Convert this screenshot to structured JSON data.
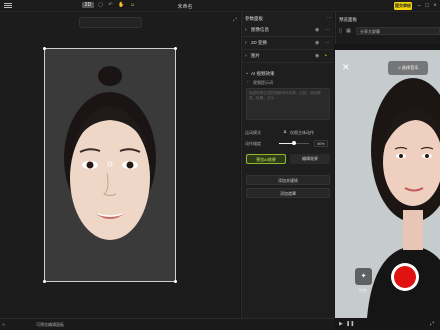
{
  "window": {
    "title": "未命名",
    "export_label": "提交审核"
  },
  "canvas": {
    "toolbar": {
      "mode_label": "2D",
      "undo_glyph": "↶",
      "redo_glyph": "↷",
      "hand_glyph": "✋",
      "face_glyph": "☺"
    },
    "expand_glyph": "⤢"
  },
  "bottom": {
    "left_label": "⟳",
    "tab_label": "可预览编辑面板"
  },
  "panel": {
    "title": "参数面板",
    "sections": [
      {
        "label": "图像信息",
        "icon": "chevron-right"
      },
      {
        "label": "2D 变换",
        "icon": "chevron-right"
      },
      {
        "label": "图片",
        "icon": "chevron-right"
      }
    ],
    "ai_section": "AI 视频效果",
    "ai_sub": "视频提示词",
    "prompt_placeholder": "描述你想生成的视频动作效果，比如：轻轻微笑、眨眼、点头...",
    "motion_label": "运动模式",
    "motion_value": "仅限主体动作",
    "strength_label": "动作幅度",
    "strength_percent": 50,
    "strength_text": "50%",
    "preview_btn": "预览AI效果",
    "edit_btn": "编辑效果",
    "add_keyframe": "添加关键帧",
    "add_mask": "添加遮罩"
  },
  "preview": {
    "title": "预览面板",
    "selector_value": "分享大屏幕",
    "music_label": "选择音乐",
    "fx_label": "特效",
    "colors": {
      "record": "#e01313",
      "accent": "#f2d40c",
      "green": "#8fb82c"
    }
  }
}
